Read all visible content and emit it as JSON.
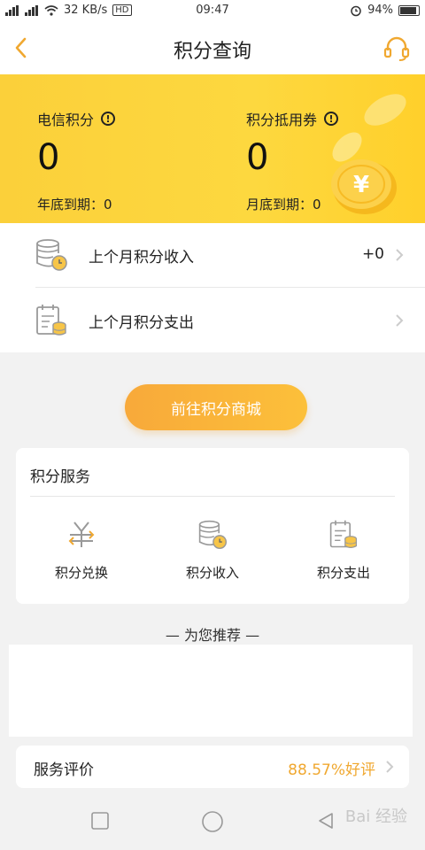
{
  "status_bar": {
    "network": "4G",
    "speed": "32 KB/s",
    "hd_label": "HD",
    "time": "09:47",
    "battery": "94%"
  },
  "nav": {
    "title": "积分查询",
    "back_icon": "chevron-left-icon",
    "support_icon": "headset-icon"
  },
  "summary": {
    "telecom_points_label": "电信积分",
    "telecom_points_value": "0",
    "telecom_points_expire": "年底到期：0",
    "voucher_points_label": "积分抵用券",
    "voucher_points_value": "0",
    "voucher_points_expire": "月底到期：0"
  },
  "list": {
    "items": [
      {
        "label": "上个月积分收入",
        "value": "+0",
        "icon": "coins-clock-icon"
      },
      {
        "label": "上个月积分支出",
        "value": "",
        "icon": "calendar-coins-icon"
      }
    ]
  },
  "mall_button_label": "前往积分商城",
  "services": {
    "title": "积分服务",
    "items": [
      {
        "label": "积分兑换",
        "icon": "exchange-icon"
      },
      {
        "label": "积分收入",
        "icon": "coins-clock-icon"
      },
      {
        "label": "积分支出",
        "icon": "calendar-coins-icon"
      }
    ]
  },
  "recommend_title": "— 为您推荐 —",
  "rating": {
    "label": "服务评价",
    "score": "88.57%好评"
  },
  "watermark": "Bai 经验",
  "colors": {
    "accent_orange": "#f0a830",
    "banner_yellow": "#fdd83f",
    "button_start": "#f8a93a",
    "button_end": "#fcc03a"
  }
}
